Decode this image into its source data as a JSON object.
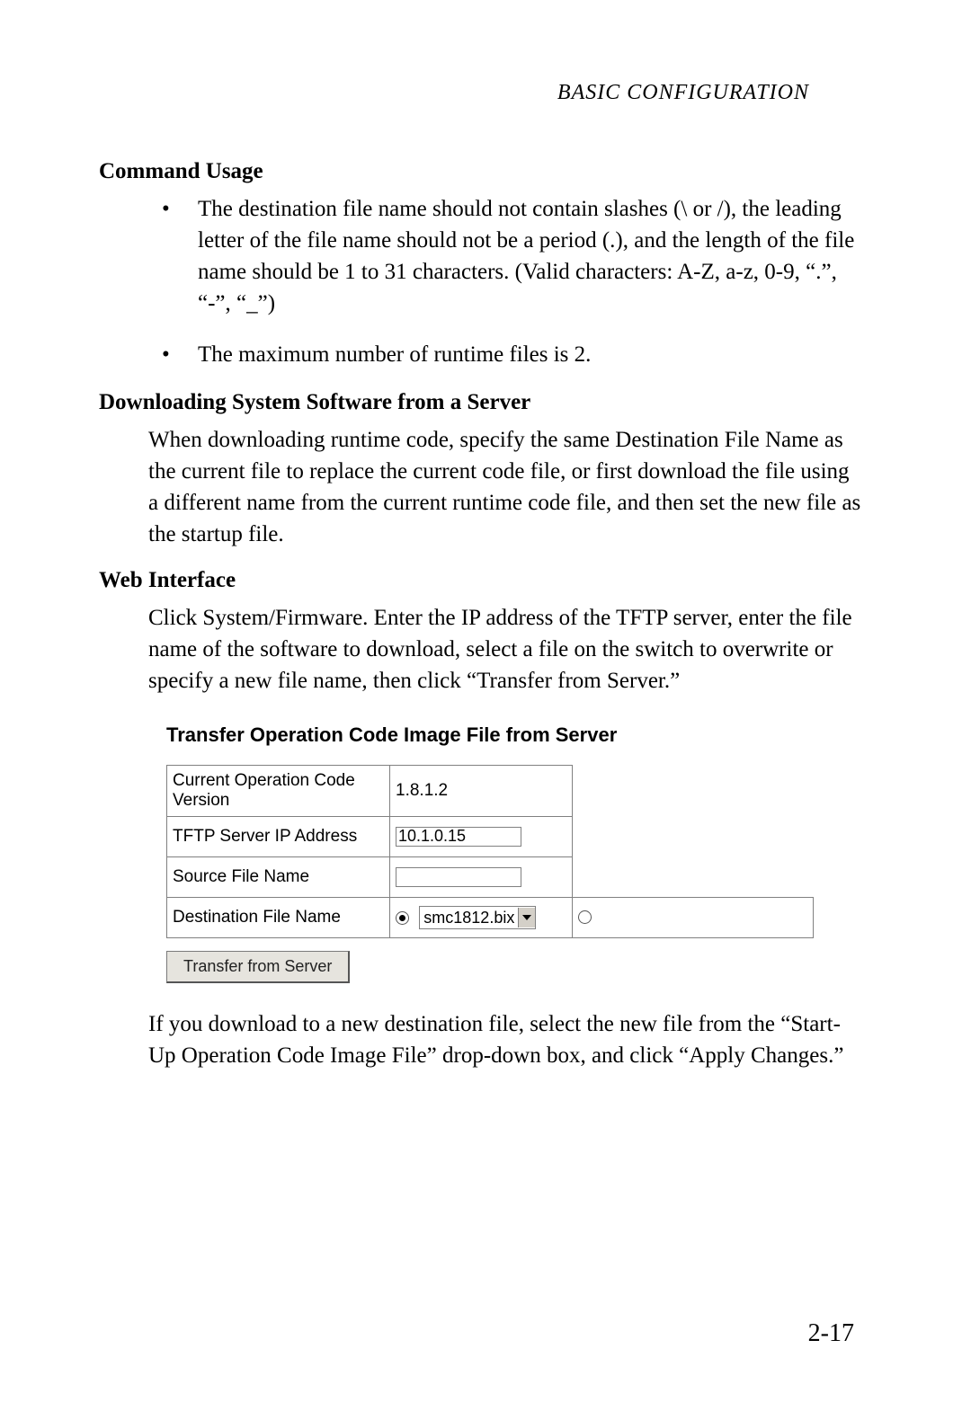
{
  "header": {
    "text": "BASIC CONFIGURATION"
  },
  "sections": {
    "cmd_usage_heading": "Command Usage",
    "bullets": {
      "b1": "The destination file name should not contain slashes (\\ or /), the leading letter of the file name should not be a period (.), and the length of the file name should be 1 to 31 characters. (Valid characters: A-Z, a-z, 0-9, “.”, “-”, “_”)",
      "b2": "The maximum number of runtime files is 2."
    },
    "download_heading": "Downloading System Software from a Server",
    "download_para": "When downloading runtime code, specify the same Destination File Name as the current file to replace the current code file, or first download the file using a different name from the current runtime code file, and then set the new file as the startup file.",
    "web_heading": "Web Interface",
    "web_para": "Click System/Firmware. Enter the IP address of the TFTP server, enter the file name of the software to download, select a file on the switch to overwrite or specify a new file name, then click “Transfer from Server.”",
    "post_para": "If you download to a new destination file, select the new file from the “Start-Up Operation Code Image File” drop-down box, and click “Apply Changes.”"
  },
  "ui": {
    "title": "Transfer Operation Code Image File from Server",
    "rows": {
      "version_label": "Current Operation Code Version",
      "version_value": "1.8.1.2",
      "tftp_label": "TFTP Server IP Address",
      "tftp_value": "10.1.0.15",
      "source_label": "Source File Name",
      "source_value": "",
      "dest_label": "Destination File Name",
      "dest_select_value": "smc1812.bix"
    },
    "button_label": "Transfer from Server"
  },
  "page_number": "2-17"
}
